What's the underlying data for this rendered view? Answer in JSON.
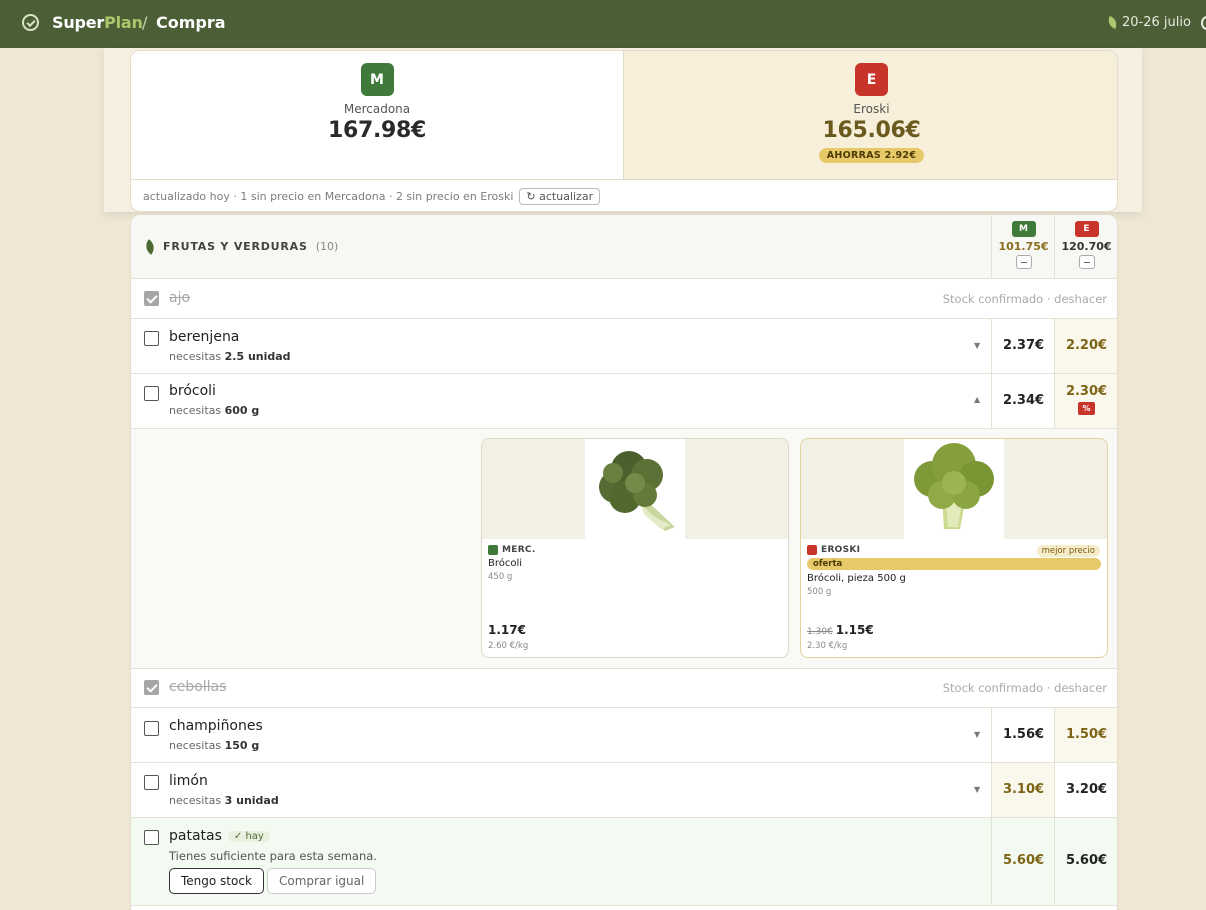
{
  "topbar": {
    "brand_a": "Super",
    "brand_b": "Plan",
    "sep": "/",
    "section": "Compra",
    "week": "20-26 julio"
  },
  "summary": {
    "mercadona": {
      "badge": "M",
      "name": "Mercadona",
      "total": "167.98€"
    },
    "eroski": {
      "badge": "E",
      "name": "Eroski",
      "total": "165.06€",
      "savings": "AHORRAS 2.92€"
    },
    "footer": "actualizado hoy · 1 sin precio en Mercadona · 2 sin precio en Eroski",
    "refresh_label": "↻ actualizar"
  },
  "category": {
    "title": "FRUTAS Y VERDURAS",
    "count": "(10)",
    "m_badge": "M",
    "e_badge": "E",
    "m_total": "101.75€",
    "e_total": "120.70€"
  },
  "items": {
    "ajo": {
      "name": "ajo",
      "note": "Stock confirmado · deshacer"
    },
    "berenjena": {
      "name": "berenjena",
      "need_prefix": "necesitas ",
      "need": "2.5 unidad",
      "m": "2.37€",
      "e": "2.20€"
    },
    "brocoli": {
      "name": "brócoli",
      "need_prefix": "necesitas ",
      "need": "600 g",
      "m": "2.34€",
      "e": "2.30€",
      "pct": "%"
    },
    "cebollas": {
      "name": "cebollas",
      "note": "Stock confirmado · deshacer"
    },
    "champinones": {
      "name": "champiñones",
      "need_prefix": "necesitas ",
      "need": "150 g",
      "m": "1.56€",
      "e": "1.50€"
    },
    "limon": {
      "name": "limón",
      "need_prefix": "necesitas ",
      "need": "3 unidad",
      "m": "3.10€",
      "e": "3.20€"
    },
    "patatas": {
      "name": "patatas",
      "hay": "✓ hay",
      "sufficient": "Tienes suficiente para esta semana.",
      "btn_stock": "Tengo stock",
      "btn_buy": "Comprar igual",
      "m": "5.60€",
      "e": "5.60€"
    }
  },
  "cards": {
    "merc": {
      "store": "MERC.",
      "product": "Brócoli",
      "qty": "450 g",
      "price": "1.17€",
      "unit": "2.60 €/kg"
    },
    "eroski": {
      "store": "EROSKI",
      "best": "mejor precio",
      "offer": "oferta",
      "product": "Brócoli, pieza 500 g",
      "qty": "500 g",
      "old_price": "1.30€",
      "price": "1.15€",
      "unit": "2.30 €/kg"
    }
  },
  "colors": {
    "topbar": "#4b5e35",
    "mercadona": "#3f7a3a",
    "eroski": "#c9342a",
    "savings": "#e8c96a",
    "best_price": "#7c6416"
  }
}
